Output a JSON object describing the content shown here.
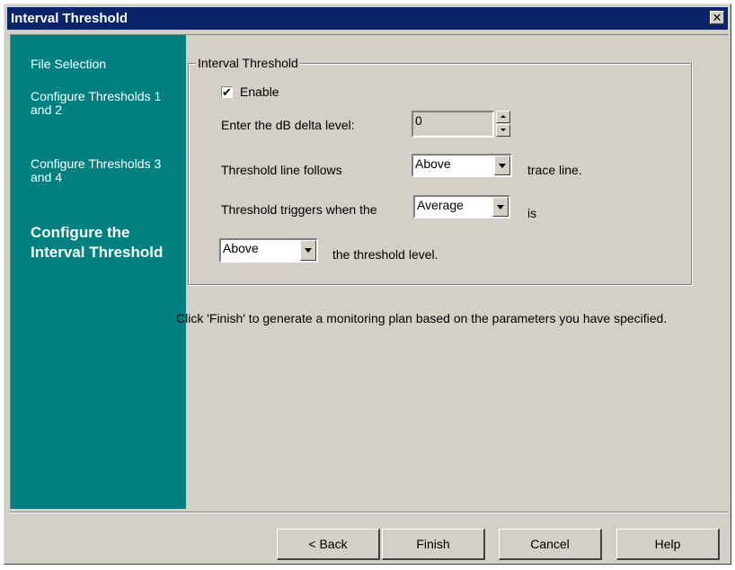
{
  "window": {
    "title": "Interval Threshold",
    "close_glyph": "✕"
  },
  "sidebar": {
    "steps": [
      {
        "label": "File Selection"
      },
      {
        "label": "Configure Thresholds 1 and 2"
      },
      {
        "label": "Configure Thresholds 3 and 4"
      },
      {
        "label": "Configure the Interval Threshold",
        "current": true
      }
    ]
  },
  "group": {
    "legend": "Interval Threshold",
    "enable_label": "Enable",
    "enable_checked": true,
    "check_glyph": "✔",
    "db_delta_label": "Enter the dB delta level:",
    "db_delta_value": "0",
    "follows_label": "Threshold line follows",
    "follows_value": "Above",
    "follows_suffix": "trace line.",
    "triggers_label": "Threshold triggers when the",
    "triggers_value": "Average",
    "triggers_suffix": "is",
    "level_value": "Above",
    "level_suffix": "the threshold level."
  },
  "info_text": "Click 'Finish' to generate a monitoring plan based on the parameters you have specified.",
  "buttons": {
    "back": "< Back",
    "finish": "Finish",
    "cancel": "Cancel",
    "help": "Help"
  },
  "colors": {
    "titlebar": "#0a246a",
    "sidebar": "#008080",
    "dialog_face": "#d4d0c8"
  },
  "icons": {
    "close": "close-icon",
    "checkmark": "checkmark-icon",
    "spin_up": "spin-up-arrow-icon",
    "spin_down": "spin-down-arrow-icon",
    "dropdown": "chevron-down-icon"
  }
}
